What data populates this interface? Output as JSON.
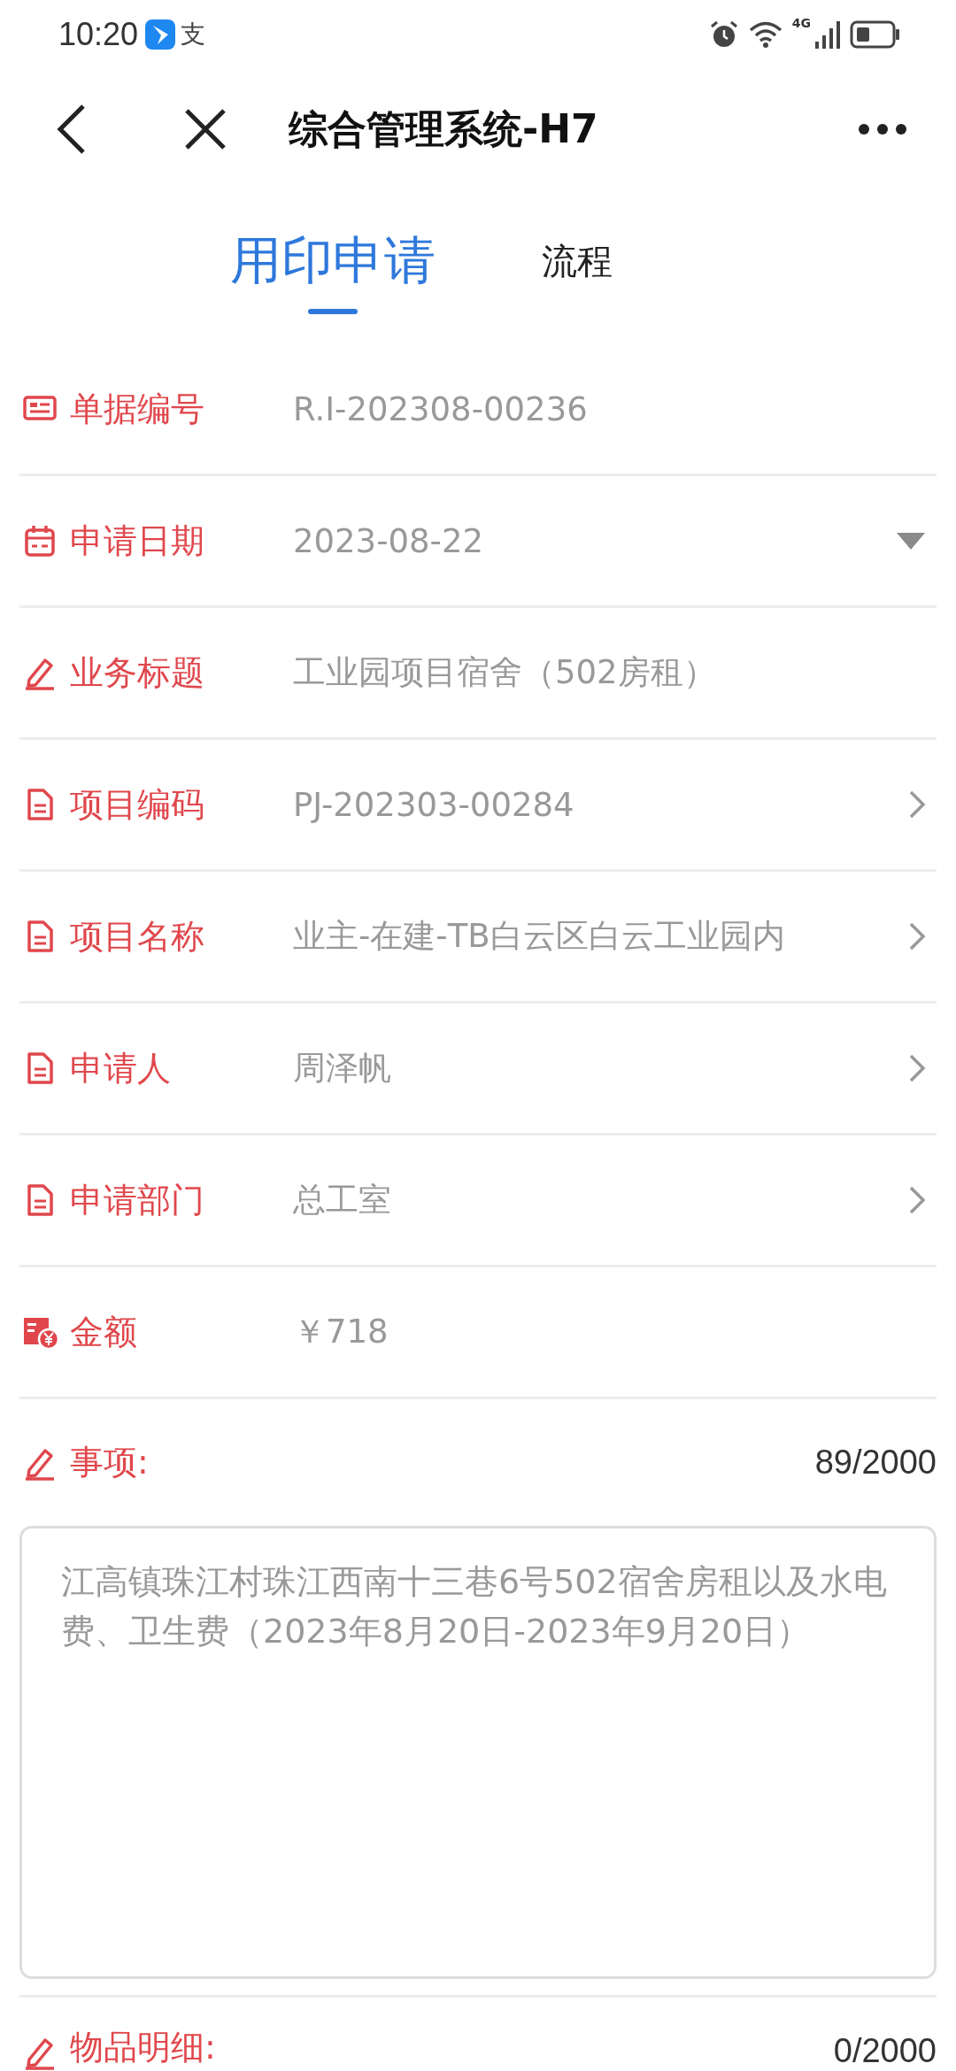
{
  "status_bar": {
    "time": "10:20",
    "app_glyph": "支",
    "network": "4G"
  },
  "header": {
    "title": "综合管理系统-H7"
  },
  "tabs": [
    {
      "label": "用印申请",
      "selected": true
    },
    {
      "label": "流程",
      "selected": false
    }
  ],
  "fields": [
    {
      "kind": "number",
      "label": "单据编号",
      "value": "R.I-202308-00236"
    },
    {
      "kind": "date",
      "label": "申请日期",
      "value": "2023-08-22"
    },
    {
      "kind": "text",
      "label": "业务标题",
      "value": "工业园项目宿舍（502房租）"
    },
    {
      "kind": "link",
      "label": "项目编码",
      "value": "PJ-202303-00284"
    },
    {
      "kind": "link",
      "label": "项目名称",
      "value": "业主-在建-TB白云区白云工业园内"
    },
    {
      "kind": "link",
      "label": "申请人",
      "value": "周泽帆"
    },
    {
      "kind": "link",
      "label": "申请部门",
      "value": "总工室"
    },
    {
      "kind": "amount",
      "label": "金额",
      "value": "￥718"
    }
  ],
  "text_sections": [
    {
      "label": "事项:",
      "counter": "89/2000",
      "value": "江高镇珠江村珠江西南十三巷6号502宿舍房租以及水电费、卫生费（2023年8月20日-2023年9月20日）"
    },
    {
      "label": "物品明细:",
      "counter": "0/2000"
    }
  ]
}
